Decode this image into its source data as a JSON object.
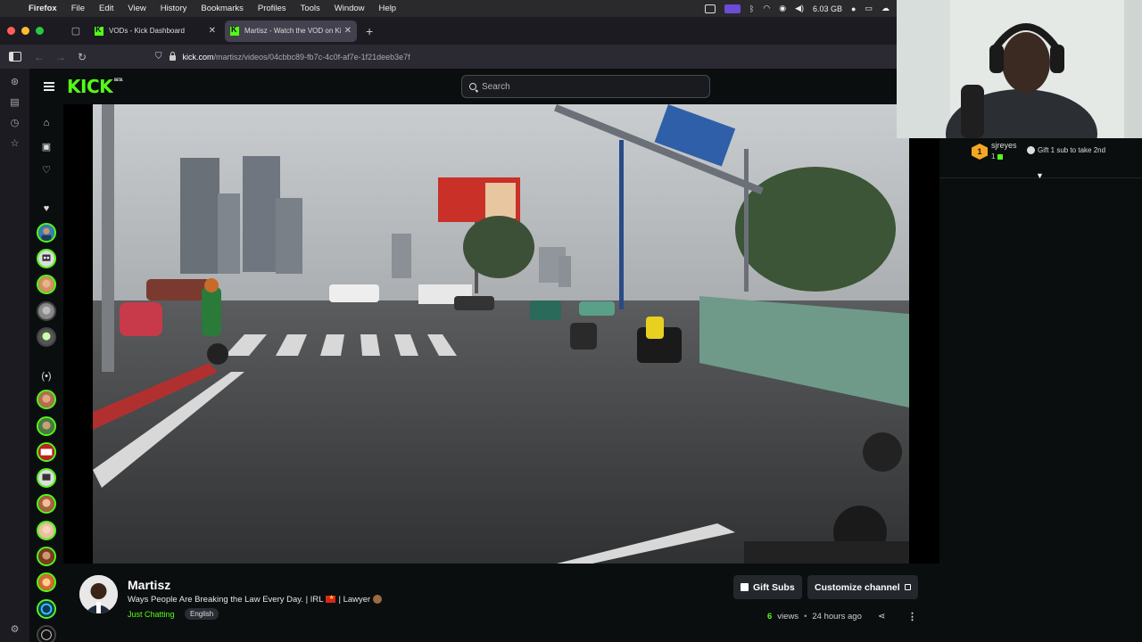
{
  "menubar": {
    "app": "Firefox",
    "items": [
      "File",
      "Edit",
      "View",
      "History",
      "Bookmarks",
      "Profiles",
      "Tools",
      "Window",
      "Help"
    ],
    "memory": "6.03 GB"
  },
  "tabs": [
    {
      "title": "VODs - Kick Dashboard",
      "active": false
    },
    {
      "title": "Martisz - Watch the VOD on Kick",
      "active": true
    }
  ],
  "address": {
    "host": "kick.com",
    "path": "/martisz/videos/04cbbc89-fb7c-4c0f-af7e-1f21deeb3e7f"
  },
  "header": {
    "logo": "KICK",
    "logo_badge": "BETA",
    "search_placeholder": "Search"
  },
  "stream": {
    "streamer": "Martisz",
    "title_a": "Ways People Are Breaking the Law Every Day. | IRL",
    "title_b": "| Lawyer",
    "category": "Just Chatting",
    "language": "English",
    "gift_button": "Gift Subs",
    "customize_button": "Customize channel",
    "views_count": "6",
    "views_label": "views",
    "time_ago": "24 hours ago"
  },
  "chat": {
    "gifter_rank": "1",
    "gifter_name": "sjreyes",
    "gifter_count": "1",
    "gift_cta": "Gift 1 sub to take 2nd"
  },
  "colors": {
    "brand_green": "#53fc18",
    "bg": "#0b0e0f",
    "gifter_gold": "#f5a623"
  }
}
